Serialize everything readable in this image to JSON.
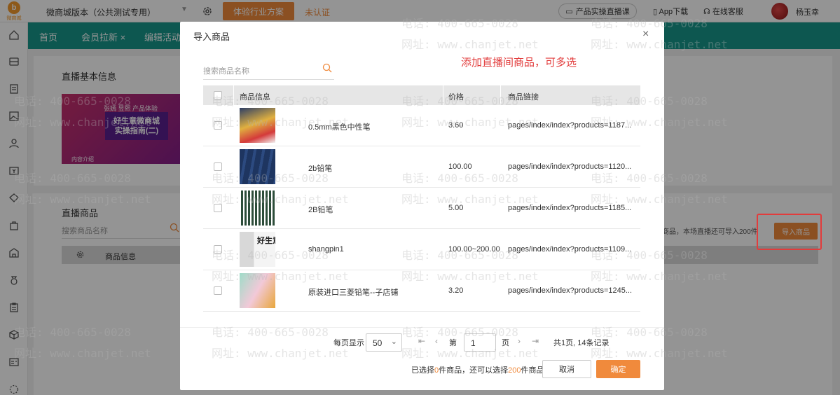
{
  "topbar": {
    "logo_text": "微商城",
    "app_title": "微商城版本（公共测试专用）",
    "trial_button": "体验行业方案",
    "unverified": "未认证",
    "live_course": "产品实操直播课",
    "app_download": "App下载",
    "online_service": "在线客服",
    "username": "杨玉幸"
  },
  "nav": {
    "tabs": [
      {
        "label": "首页"
      },
      {
        "label": "会员拉新 ×"
      },
      {
        "label": "编辑活动"
      }
    ]
  },
  "page": {
    "basic_info_title": "直播基本信息",
    "banner_line1": "张嫣 昱熙 产品体验",
    "banner_line2": "好生意微商城",
    "banner_line3": "实操指南(二)",
    "banner_footer": "内容介绍",
    "live_products_title": "直播商品",
    "search_placeholder": "搜索商品名称",
    "table_header_info": "商品信息",
    "import_hint": "件商品，本场直播还可导入200件",
    "import_button": "导入商品"
  },
  "modal": {
    "title": "导入商品",
    "close": "×",
    "annotation": "添加直播间商品，可多选",
    "search_placeholder": "搜索商品名称",
    "columns": {
      "info": "商品信息",
      "price": "价格",
      "link": "商品链接"
    },
    "rows": [
      {
        "name": "0.5mm黑色中性笔",
        "price": "3.60",
        "link": "pages/index/index?products=1187..."
      },
      {
        "name": "2b铅笔",
        "price": "100.00",
        "link": "pages/index/index?products=1120..."
      },
      {
        "name": "2B铅笔",
        "price": "5.00",
        "link": "pages/index/index?products=1185..."
      },
      {
        "name": "shangpin1",
        "price": "100.00~200.00",
        "link": "pages/index/index?products=1109...",
        "thumb_text": "好生意"
      },
      {
        "name": "原装进口三菱铅笔--子店铺",
        "price": "3.20",
        "link": "pages/index/index?products=1245..."
      }
    ],
    "pager": {
      "per_page_label": "每页显示",
      "per_page": "50",
      "page_prefix": "第",
      "page": "1",
      "page_suffix": "页",
      "total": "共1页, 14条记录"
    },
    "footer": {
      "selected_prefix": "已选择",
      "selected_count": "0",
      "selected_mid": "件商品，还可以选择",
      "remaining": "200",
      "selected_suffix": "件商品",
      "cancel": "取消",
      "confirm": "确定"
    }
  },
  "watermark": {
    "phone": "电话: 400-665-0028",
    "site": "网址: www.chanjet.net"
  },
  "colors": {
    "teal": "#17968b",
    "orange": "#f08a3c",
    "red": "#e23c3c"
  }
}
